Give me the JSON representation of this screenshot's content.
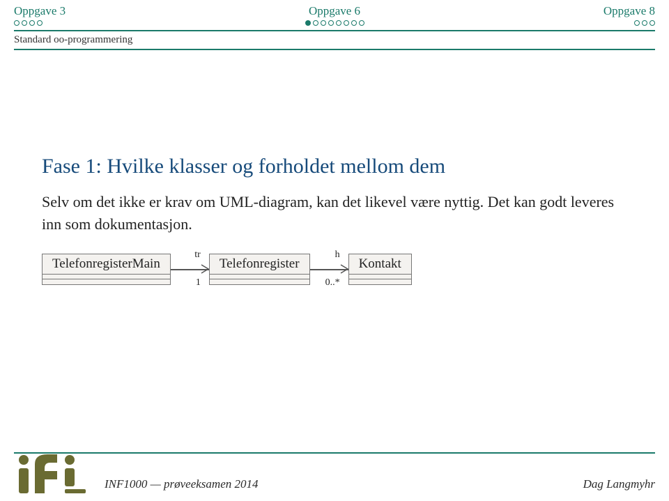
{
  "nav": {
    "left": {
      "label": "Oppgave 3",
      "total": 4,
      "current": 0
    },
    "center": {
      "label": "Oppgave 6",
      "total": 8,
      "current": 1
    },
    "right": {
      "label": "Oppgave 8",
      "total": 3,
      "current": 0
    }
  },
  "subheading": "Standard oo-programmering",
  "slide": {
    "title": "Fase 1: Hvilke klasser og forholdet mellom dem",
    "body": "Selv om det ikke er krav om UML-diagram, kan det likevel være nyttig. Det kan godt leveres inn som dokumentasjon."
  },
  "uml": {
    "classes": [
      "TelefonregisterMain",
      "Telefonregister",
      "Kontakt"
    ],
    "assoc1": {
      "role": "tr",
      "mult": "1"
    },
    "assoc2": {
      "role": "h",
      "mult": "0..*"
    }
  },
  "footer": {
    "left": "INF1000 — prøveeksamen 2014",
    "right": "Dag Langmyhr"
  }
}
